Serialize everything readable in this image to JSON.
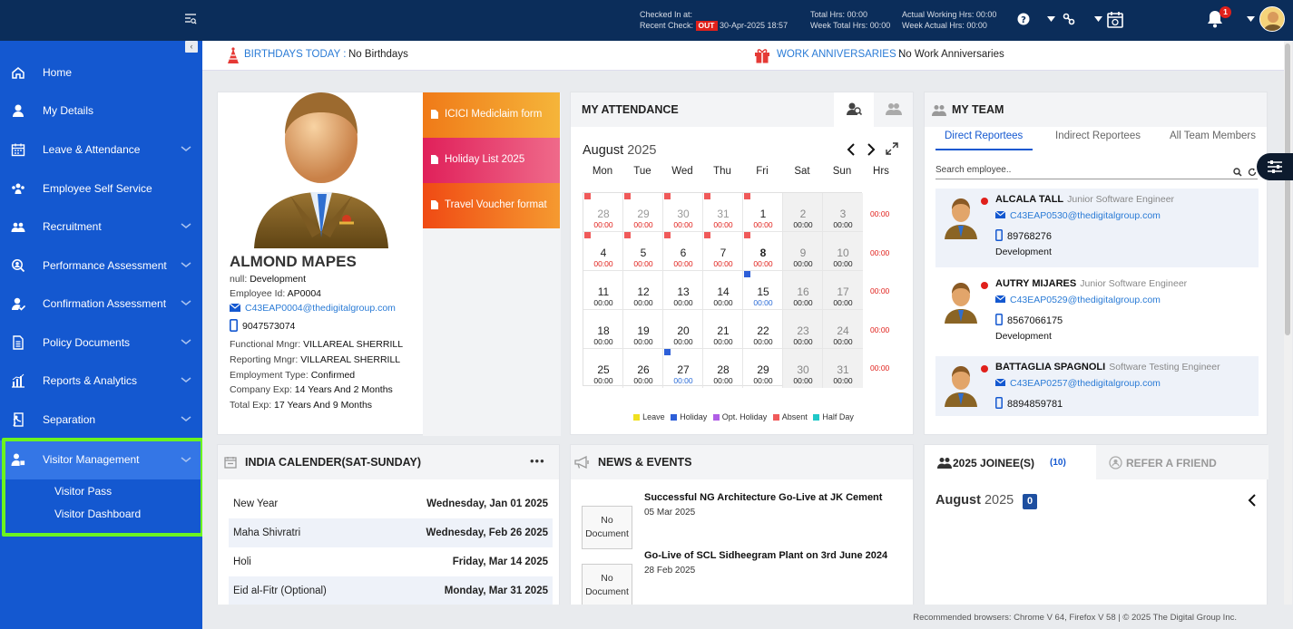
{
  "topbar": {
    "checked_in_label": "Checked In at:",
    "recent_check_label": "Recent Check:",
    "out_badge": "OUT",
    "recent_check_time": "30-Apr-2025 18:57",
    "total_hrs": "Total Hrs: 00:00",
    "week_total_hrs": "Week Total Hrs: 00:00",
    "actual_working_hrs": "Actual Working Hrs: 00:00",
    "week_actual_hrs": "Week Actual Hrs: 00:00",
    "notification_count": "1"
  },
  "sidebar": {
    "items": [
      {
        "label": "Home",
        "icon": "home-icon"
      },
      {
        "label": "My Details",
        "icon": "user-icon"
      },
      {
        "label": "Leave & Attendance",
        "icon": "calendar-icon"
      },
      {
        "label": "Employee Self Service",
        "icon": "people-icon"
      },
      {
        "label": "Recruitment",
        "icon": "team-icon"
      },
      {
        "label": "Performance Assessment",
        "icon": "search-user-icon"
      },
      {
        "label": "Confirmation Assessment",
        "icon": "user-check-icon"
      },
      {
        "label": "Policy Documents",
        "icon": "document-icon"
      },
      {
        "label": "Reports & Analytics",
        "icon": "chart-icon"
      },
      {
        "label": "Separation",
        "icon": "exit-icon"
      },
      {
        "label": "Visitor Management",
        "icon": "visitor-icon"
      }
    ],
    "sub_items": [
      "Visitor Pass",
      "Visitor Dashboard"
    ]
  },
  "banner": {
    "birthdays_label": "BIRTHDAYS TODAY :",
    "birthdays_value": "No Birthdays",
    "anniv_label": "WORK ANNIVERSARIES :",
    "anniv_value": "No Work Anniversaries"
  },
  "profile": {
    "name": "ALMOND MAPES",
    "dept_label": "null:",
    "dept": "Development",
    "emp_id_label": "Employee Id:",
    "emp_id": "AP0004",
    "email": "C43EAP0004@thedigitalgroup.com",
    "phone": "9047573074",
    "functional_label": "Functional Mngr:",
    "functional": "VILLAREAL SHERRILL",
    "reporting_label": "Reporting Mngr:",
    "reporting": "VILLAREAL SHERRILL",
    "emp_type_label": "Employment Type:",
    "emp_type": "Confirmed",
    "company_exp_label": "Company Exp:",
    "company_exp": "14 Years And 2 Months",
    "total_exp_label": "Total Exp:",
    "total_exp": "17 Years And 9 Months",
    "links": [
      "ICICI Mediclaim form",
      "Holiday List 2025",
      "Travel Voucher format"
    ]
  },
  "attendance": {
    "title": "MY ATTENDANCE",
    "month": "August",
    "year": "2025",
    "days": [
      "Mon",
      "Tue",
      "Wed",
      "Thu",
      "Fri",
      "Sat",
      "Sun"
    ],
    "hrs_label": "Hrs",
    "week_hrs": [
      "00:00",
      "00:00",
      "00:00",
      "00:00",
      "00:00"
    ],
    "legend": [
      "Leave",
      "Holiday",
      "Opt. Holiday",
      "Absent",
      "Half Day"
    ]
  },
  "team": {
    "title": "MY TEAM",
    "tabs": [
      "Direct Reportees",
      "Indirect Reportees",
      "All Team Members"
    ],
    "search_placeholder": "Search employee..",
    "members": [
      {
        "name": "ALCALA TALL",
        "role": "Junior Software Engineer",
        "email": "C43EAP0530@thedigitalgroup.com",
        "phone": "89768276",
        "dept": "Development"
      },
      {
        "name": "AUTRY MIJARES",
        "role": "Junior Software Engineer",
        "email": "C43EAP0529@thedigitalgroup.com",
        "phone": "8567066175",
        "dept": "Development"
      },
      {
        "name": "BATTAGLIA SPAGNOLI",
        "role": "Software Testing Engineer",
        "email": "C43EAP0257@thedigitalgroup.com",
        "phone": "8894859781",
        "dept": ""
      }
    ]
  },
  "holidays": {
    "title": "INDIA CALENDER(SAT-SUNDAY)",
    "more": "•••",
    "rows": [
      {
        "name": "New Year",
        "date": "Wednesday, Jan 01 2025"
      },
      {
        "name": "Maha Shivratri",
        "date": "Wednesday, Feb 26 2025"
      },
      {
        "name": "Holi",
        "date": "Friday, Mar 14 2025"
      },
      {
        "name": "Eid al-Fitr (Optional)",
        "date": "Monday, Mar 31 2025"
      }
    ]
  },
  "news": {
    "title": "NEWS & EVENTS",
    "no_doc": "No Document",
    "items": [
      {
        "title": "Successful NG Architecture Go-Live at JK Cement",
        "date": "05 Mar 2025"
      },
      {
        "title": "Go-Live of SCL Sidheegram Plant on 3rd June 2024",
        "date": "28 Feb 2025"
      }
    ]
  },
  "joinee": {
    "title": "2025 JOINEE(S)",
    "count": "(10)",
    "refer": "REFER A FRIEND",
    "month": "August",
    "year": "2025",
    "month_count": "0"
  },
  "footer": "Recommended browsers: Chrome V 64, Firefox V 58  |  © 2025 The Digital Group Inc."
}
